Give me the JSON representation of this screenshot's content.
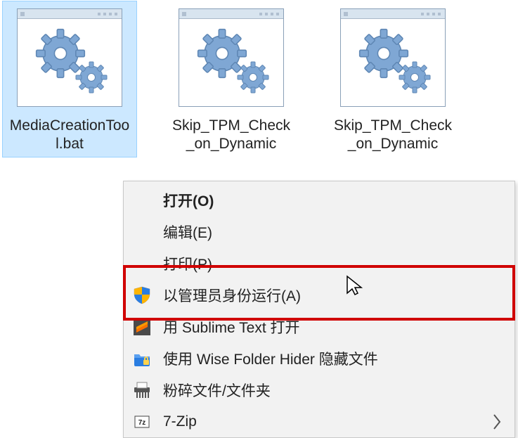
{
  "files": [
    {
      "name": "MediaCreationTool.bat",
      "selected": true
    },
    {
      "name": "Skip_TPM_Check_on_Dynamic",
      "selected": false
    },
    {
      "name": "Skip_TPM_Check_on_Dynamic",
      "selected": false
    }
  ],
  "menu": {
    "open": "打开(O)",
    "edit": "编辑(E)",
    "print": "打印(P)",
    "runAdmin": "以管理员身份运行(A)",
    "sublime": "用 Sublime Text 打开",
    "wise": "使用 Wise Folder Hider 隐藏文件",
    "shred": "粉碎文件/文件夹",
    "sevenZip": "7-Zip"
  }
}
